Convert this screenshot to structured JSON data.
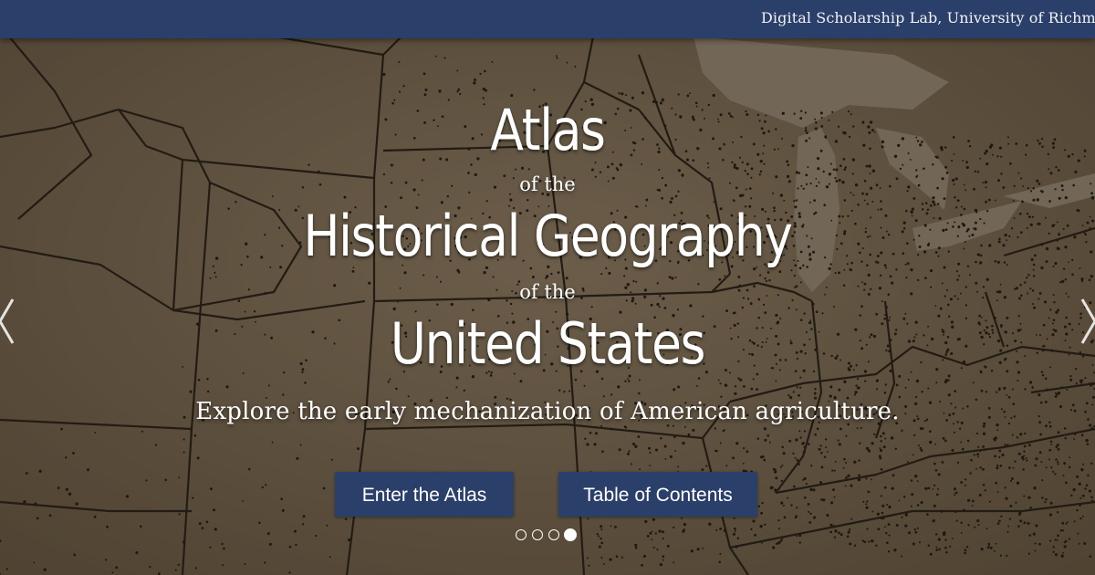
{
  "header": {
    "org_link": "Digital Scholarship Lab, University of Richmond"
  },
  "hero": {
    "title_line1": "Atlas",
    "connector1": "of the",
    "title_line2": "Historical Geography",
    "connector2": "of the",
    "title_line3": "United States",
    "subtitle": "Explore the early mechanization of American agriculture."
  },
  "buttons": {
    "enter_label": "Enter the Atlas",
    "toc_label": "Table of Contents"
  },
  "carousel": {
    "slide_count": 4,
    "active_slide": 4,
    "prev_icon": "chevron-left-icon",
    "next_icon": "chevron-right-icon"
  },
  "colors": {
    "header_bg": "#2b3f6b",
    "button_bg": "#2b3f6b",
    "map_tone": "#8a7b63",
    "text": "#ffffff"
  }
}
